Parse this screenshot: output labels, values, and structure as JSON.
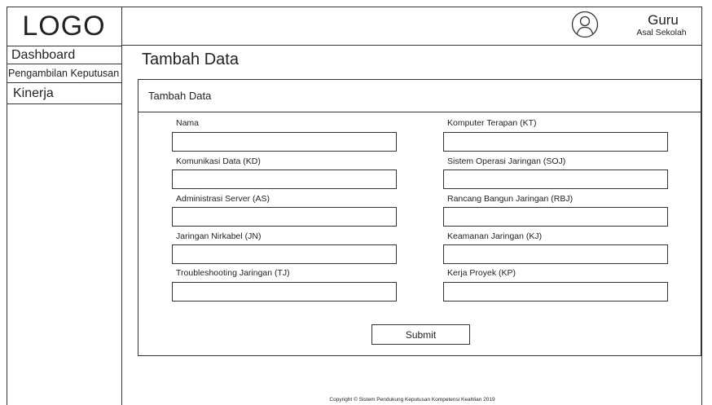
{
  "sidebar": {
    "logo": "LOGO",
    "items": [
      {
        "label": "Dashboard"
      },
      {
        "label": "Pengambilan Keputusan"
      },
      {
        "label": "Kinerja"
      }
    ]
  },
  "header": {
    "user_name": "Guru",
    "user_school": "Asal Sekolah",
    "avatar_icon": "user-circle-icon"
  },
  "page_title": "Tambah Data",
  "card": {
    "title": "Tambah Data",
    "fields_left": [
      {
        "label": "Nama",
        "value": ""
      },
      {
        "label": "Komunikasi Data (KD)",
        "value": ""
      },
      {
        "label": "Administrasi Server (AS)",
        "value": ""
      },
      {
        "label": "Jaringan Nirkabel (JN)",
        "value": ""
      },
      {
        "label": "Troubleshooting Jaringan (TJ)",
        "value": ""
      }
    ],
    "fields_right": [
      {
        "label": "Komputer Terapan (KT)",
        "value": ""
      },
      {
        "label": "Sistem Operasi Jaringan (SOJ)",
        "value": ""
      },
      {
        "label": "Rancang Bangun Jaringan (RBJ)",
        "value": ""
      },
      {
        "label": "Keamanan Jaringan (KJ)",
        "value": ""
      },
      {
        "label": "Kerja Proyek (KP)",
        "value": ""
      }
    ],
    "submit_label": "Submit"
  },
  "footer": "Copyright © Sistem Pendukung Keputusan Kompetensi Keahlian 2019"
}
